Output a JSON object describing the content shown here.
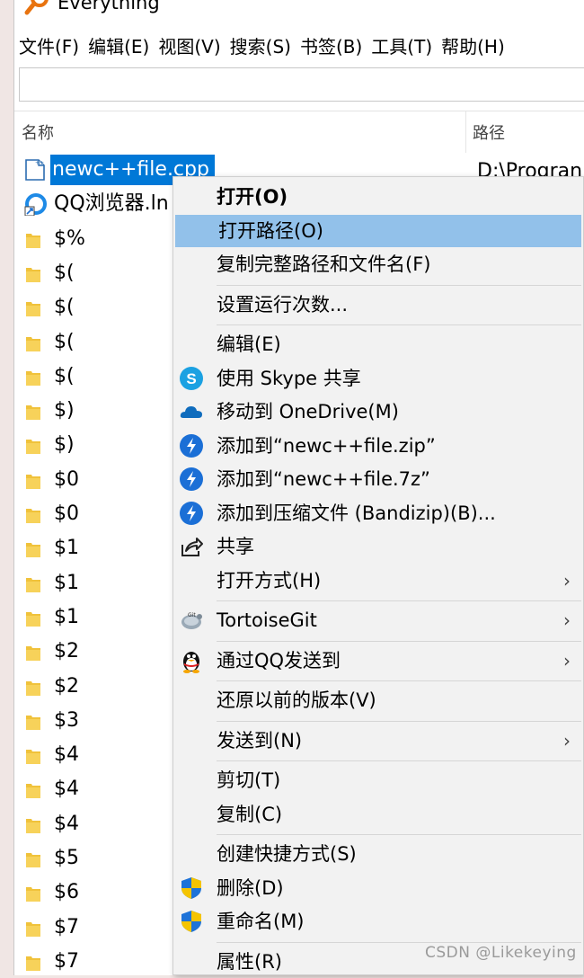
{
  "app": {
    "title": "Everything"
  },
  "menu": [
    "文件(F)",
    "编辑(E)",
    "视图(V)",
    "搜索(S)",
    "书签(B)",
    "工具(T)",
    "帮助(H)"
  ],
  "search": {
    "value": ""
  },
  "columns": {
    "name": "名称",
    "path": "路径"
  },
  "rows": [
    {
      "name": "newc++file.cpp",
      "path": "D:\\Progran",
      "icon": "cpp-file-icon",
      "selected": true
    },
    {
      "name": "QQ浏览器.ln",
      "path": "",
      "icon": "qq-browser-icon"
    },
    {
      "name": "$%",
      "icon": "folder-icon"
    },
    {
      "name": "$(",
      "icon": "folder-icon"
    },
    {
      "name": "$(",
      "icon": "folder-icon"
    },
    {
      "name": "$(",
      "icon": "folder-icon"
    },
    {
      "name": "$(",
      "icon": "folder-icon"
    },
    {
      "name": "$)",
      "icon": "folder-icon"
    },
    {
      "name": "$)",
      "icon": "folder-icon"
    },
    {
      "name": "$0",
      "icon": "folder-icon"
    },
    {
      "name": "$0",
      "icon": "folder-icon"
    },
    {
      "name": "$1",
      "icon": "folder-icon"
    },
    {
      "name": "$1",
      "icon": "folder-icon"
    },
    {
      "name": "$1",
      "icon": "folder-icon"
    },
    {
      "name": "$2",
      "icon": "folder-icon"
    },
    {
      "name": "$2",
      "icon": "folder-icon"
    },
    {
      "name": "$3",
      "icon": "folder-icon"
    },
    {
      "name": "$4",
      "icon": "folder-icon"
    },
    {
      "name": "$4",
      "icon": "folder-icon"
    },
    {
      "name": "$4",
      "icon": "folder-icon"
    },
    {
      "name": "$5",
      "icon": "folder-icon"
    },
    {
      "name": "$6",
      "icon": "folder-icon"
    },
    {
      "name": "$7",
      "icon": "folder-icon"
    },
    {
      "name": "$7",
      "icon": "folder-icon"
    }
  ],
  "context_menu": [
    {
      "label": "打开(O)",
      "bold": true
    },
    {
      "label": "打开路径(O)",
      "highlighted": true
    },
    {
      "label": "复制完整路径和文件名(F)"
    },
    {
      "separator": true
    },
    {
      "label": "设置运行次数..."
    },
    {
      "separator": true
    },
    {
      "label": "编辑(E)"
    },
    {
      "label": "使用 Skype 共享",
      "icon": "skype-icon"
    },
    {
      "label": "移动到 OneDrive(M)",
      "icon": "onedrive-icon"
    },
    {
      "label": "添加到“newc++file.zip”",
      "icon": "bandizip-icon"
    },
    {
      "label": "添加到“newc++file.7z”",
      "icon": "bandizip-icon"
    },
    {
      "label": "添加到压缩文件 (Bandizip)(B)...",
      "icon": "bandizip-icon"
    },
    {
      "label": "共享",
      "icon": "share-icon"
    },
    {
      "label": "打开方式(H)",
      "submenu": true
    },
    {
      "separator": true
    },
    {
      "label": "TortoiseGit",
      "icon": "tortoisegit-icon",
      "submenu": true
    },
    {
      "separator": true
    },
    {
      "label": "通过QQ发送到",
      "icon": "qq-penguin-icon",
      "submenu": true
    },
    {
      "separator": true
    },
    {
      "label": "还原以前的版本(V)"
    },
    {
      "separator": true
    },
    {
      "label": "发送到(N)",
      "submenu": true
    },
    {
      "separator": true
    },
    {
      "label": "剪切(T)"
    },
    {
      "label": "复制(C)"
    },
    {
      "separator": true
    },
    {
      "label": "创建快捷方式(S)"
    },
    {
      "label": "删除(D)",
      "icon": "shield-icon"
    },
    {
      "label": "重命名(M)",
      "icon": "shield-icon"
    },
    {
      "separator": true
    },
    {
      "label": "属性(R)"
    }
  ],
  "watermark": "CSDN @Likekeying",
  "colors": {
    "selection": "#0078d7",
    "menu_highlight": "#92c1ea",
    "menu_bg": "#f2f2f2",
    "folder": "#f0c23b"
  }
}
